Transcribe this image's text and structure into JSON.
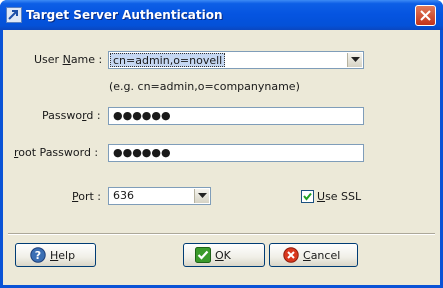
{
  "window": {
    "title": "Target Server Authentication"
  },
  "form": {
    "user_name_label_pre": "User ",
    "user_name_label_u": "N",
    "user_name_label_post": "ame :",
    "user_name_value": "cn=admin,o=novell",
    "user_name_hint": "(e.g. cn=admin,o=companyname)",
    "password_label_pre": "Passwo",
    "password_label_u": "r",
    "password_label_post": "d :",
    "password_value": "●●●●●●",
    "root_password_label_u": "r",
    "root_password_label_post": "oot Password :",
    "root_password_value": "●●●●●●",
    "port_label_u": "P",
    "port_label_post": "ort :",
    "port_value": "636",
    "use_ssl_label_u": "U",
    "use_ssl_label_post": "se SSL",
    "use_ssl_checked": true
  },
  "buttons": {
    "help_u": "H",
    "help_post": "elp",
    "ok_u": "O",
    "ok_post": "K",
    "cancel_u": "C",
    "cancel_post": "ancel"
  },
  "colors": {
    "titlebar": "#0554e0",
    "dialog_bg": "#ece9d8",
    "field_border": "#7f9db9",
    "ok_icon": "#3a9a2a",
    "cancel_icon": "#d9381e",
    "help_icon": "#3b6fb4"
  }
}
